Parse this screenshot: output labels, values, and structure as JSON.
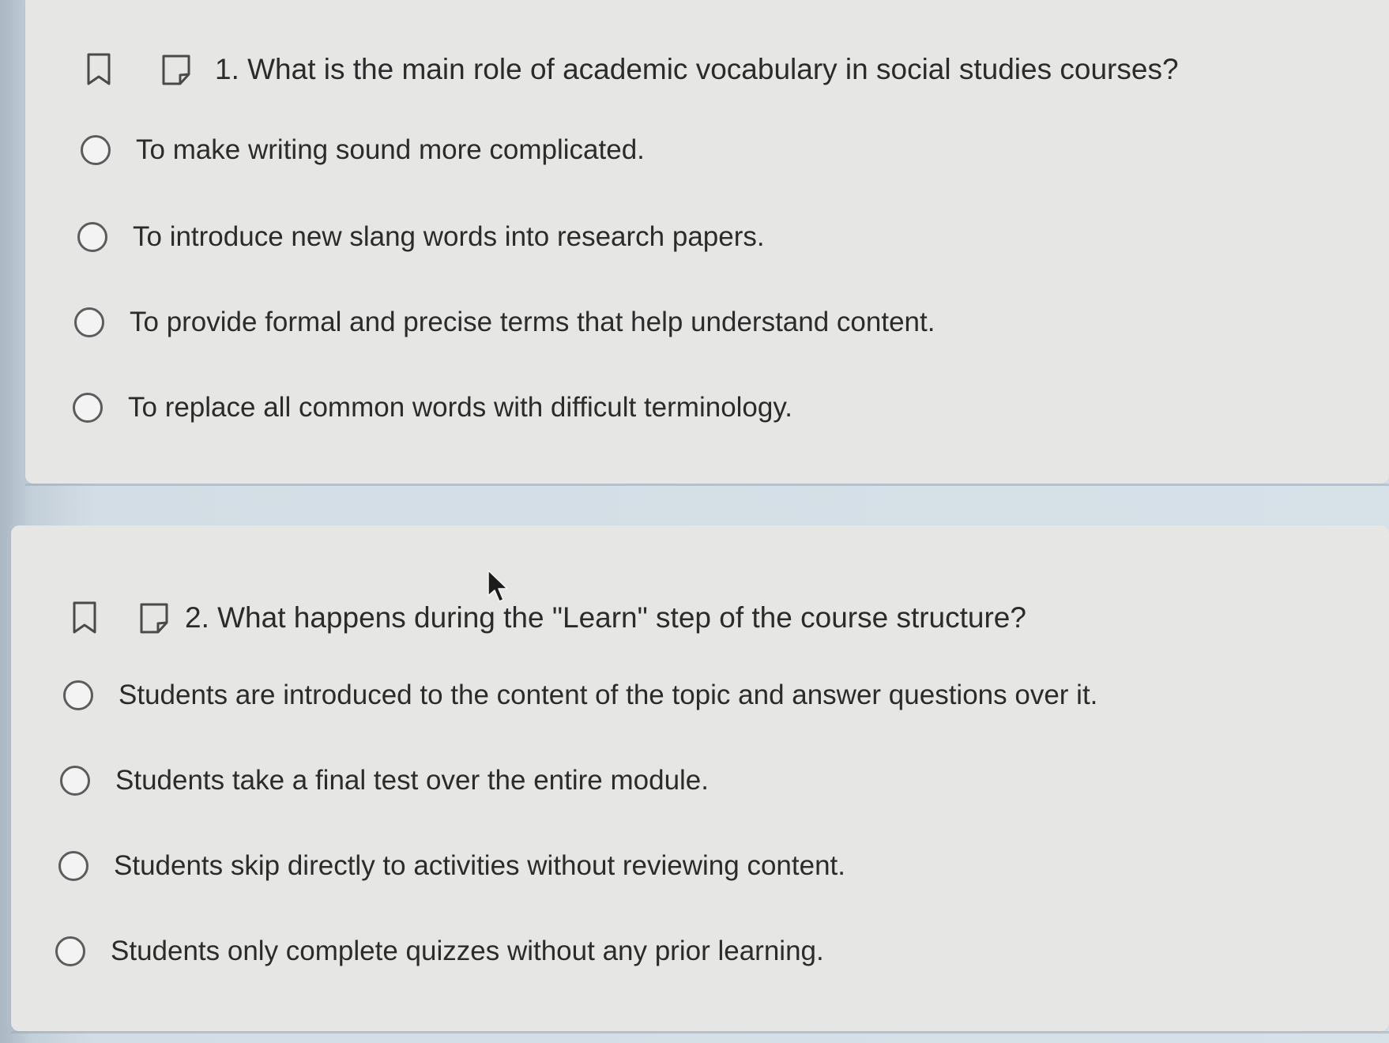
{
  "questions": [
    {
      "text": "1. What is the main role of academic vocabulary in social studies courses?",
      "options": [
        "To make writing sound more complicated.",
        "To introduce new slang words into research papers.",
        "To provide formal and precise terms that help understand content.",
        "To replace all common words with difficult terminology."
      ],
      "selected_index": null
    },
    {
      "text": "2. What happens during the \"Learn\" step of the course structure?",
      "options": [
        "Students are introduced to the content of the topic and answer questions over it.",
        "Students take a final test over the entire module.",
        "Students skip directly to activities without reviewing content.",
        "Students only complete quizzes without any prior learning."
      ],
      "selected_index": null
    }
  ],
  "icons": {
    "bookmark": "bookmark-icon",
    "note": "note-icon",
    "radio": "radio-unselected-icon",
    "cursor": "mouse-pointer-icon"
  },
  "colors": {
    "card_background": "#e6e6e5",
    "page_background": "#d3dde5",
    "text": "#2b2b2b",
    "radio_border": "#5c5c5c"
  }
}
